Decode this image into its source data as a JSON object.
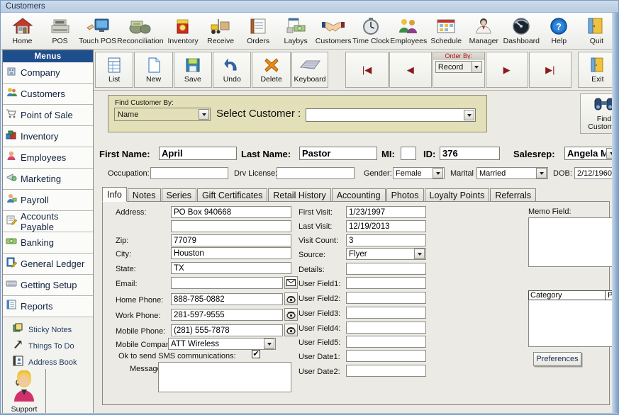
{
  "window": {
    "title": "Customers"
  },
  "toolbar": {
    "items": [
      {
        "label": "Home",
        "icon": "house-icon"
      },
      {
        "label": "POS",
        "icon": "cash-register-icon"
      },
      {
        "label": "Touch POS",
        "icon": "touch-monitor-icon"
      },
      {
        "label": "Reconciliation",
        "icon": "money-bags-icon"
      },
      {
        "label": "Inventory",
        "icon": "inventory-box-icon"
      },
      {
        "label": "Receive",
        "icon": "forklift-icon"
      },
      {
        "label": "Orders",
        "icon": "order-form-icon"
      },
      {
        "label": "Laybys",
        "icon": "layaway-money-icon"
      },
      {
        "label": "Customers",
        "icon": "handshake-icon"
      },
      {
        "label": "Time Clock",
        "icon": "stopwatch-icon"
      },
      {
        "label": "Employees",
        "icon": "employees-icon"
      },
      {
        "label": "Schedule",
        "icon": "calendar-icon"
      },
      {
        "label": "Manager",
        "icon": "manager-person-icon"
      },
      {
        "label": "Dashboard",
        "icon": "gauge-icon"
      },
      {
        "label": "Help",
        "icon": "question-circle-icon"
      },
      {
        "label": "Quit",
        "icon": "exit-door-icon"
      }
    ]
  },
  "recordbar": {
    "buttons": [
      {
        "label": "List",
        "icon": "list-grid-icon"
      },
      {
        "label": "New",
        "icon": "new-page-icon"
      },
      {
        "label": "Save",
        "icon": "floppy-disk-icon"
      },
      {
        "label": "Undo",
        "icon": "undo-arrow-icon"
      },
      {
        "label": "Delete",
        "icon": "delete-x-icon"
      },
      {
        "label": "Keyboard",
        "icon": "keyboard-icon"
      }
    ],
    "nav": {
      "first": "|◀",
      "prev": "◀",
      "next": "▶",
      "last": "▶|"
    },
    "order_by_label": "Order By:",
    "order_by_value": "Record",
    "exit_label": "Exit"
  },
  "sidebar": {
    "header": "Menus",
    "items": [
      {
        "label": "Company",
        "icon": "building-icon"
      },
      {
        "label": "Customers",
        "icon": "customers-icon"
      },
      {
        "label": "Point of Sale",
        "icon": "shopping-cart-icon"
      },
      {
        "label": "Inventory",
        "icon": "boxes-icon"
      },
      {
        "label": "Employees",
        "icon": "employee-icon"
      },
      {
        "label": "Marketing",
        "icon": "megaphone-icon"
      },
      {
        "label": "Payroll",
        "icon": "payroll-icon"
      },
      {
        "label": "Accounts Payable",
        "icon": "invoice-pencil-icon"
      },
      {
        "label": "Banking",
        "icon": "banknote-icon"
      },
      {
        "label": "General Ledger",
        "icon": "ledger-pencil-icon"
      },
      {
        "label": "Getting Setup",
        "icon": "setup-keyboard-icon"
      },
      {
        "label": "Reports",
        "icon": "report-book-icon"
      }
    ],
    "sub_items": [
      {
        "label": "Sticky Notes",
        "icon": "sticky-note-icon"
      },
      {
        "label": "Things To Do",
        "icon": "hammer-icon"
      },
      {
        "label": "Address Book",
        "icon": "address-book-icon"
      }
    ],
    "support": {
      "label": "Support",
      "icon": "support-agent-icon"
    }
  },
  "find": {
    "find_by_label": "Find Customer By:",
    "find_by_value": "Name",
    "select_customer_label": "Select Customer :",
    "select_customer_value": "",
    "find_button_line1": "Find",
    "find_button_line2": "Customer",
    "find_button_icon": "binoculars-icon"
  },
  "header_fields": {
    "first_name_label": "First Name:",
    "first_name_value": "April",
    "last_name_label": "Last Name:",
    "last_name_value": "Pastor",
    "mi_label": "MI:",
    "mi_value": "",
    "id_label": "ID:",
    "id_value": "376",
    "salesrep_label": "Salesrep:",
    "salesrep_value": "Angela Meyer",
    "occupation_label": "Occupation:",
    "occupation_value": "",
    "drv_license_label": "Drv License:",
    "drv_license_value": "",
    "gender_label": "Gender:",
    "gender_value": "Female",
    "marital_label": "Marital",
    "marital_value": "Married",
    "dob_label": "DOB:",
    "dob_value": "2/12/1960"
  },
  "tabs": [
    {
      "label": "Info",
      "active": true
    },
    {
      "label": "Notes",
      "active": false
    },
    {
      "label": "Series",
      "active": false
    },
    {
      "label": "Gift Certificates",
      "active": false
    },
    {
      "label": "Retail History",
      "active": false
    },
    {
      "label": "Accounting",
      "active": false
    },
    {
      "label": "Photos",
      "active": false
    },
    {
      "label": "Loyalty Points",
      "active": false
    },
    {
      "label": "Referrals",
      "active": false
    }
  ],
  "info": {
    "address_label": "Address:",
    "address_value": "PO Box 940668",
    "address2_value": "",
    "zip_label": "Zip:",
    "zip_value": "77079",
    "city_label": "City:",
    "city_value": "Houston",
    "state_label": "State:",
    "state_value": "TX",
    "email_label": "Email:",
    "email_value": "",
    "email_icon": "envelope-icon",
    "home_phone_label": "Home Phone:",
    "home_phone_value": "888-785-0882",
    "home_phone_icon": "telephone-icon",
    "work_phone_label": "Work Phone:",
    "work_phone_value": "281-597-9555",
    "work_phone_icon": "telephone-icon",
    "mobile_phone_label": "Mobile Phone:",
    "mobile_phone_value": "(281) 555-7878",
    "mobile_phone_icon": "telephone-icon",
    "mobile_company_label": "Mobile Company:",
    "mobile_company_value": "ATT Wireless",
    "sms_label": "Ok to send SMS communications:",
    "sms_checked": "✔",
    "message_label": "Message:",
    "message_value": "",
    "first_visit_label": "First Visit:",
    "first_visit_value": "1/23/1997",
    "last_visit_label": "Last Visit:",
    "last_visit_value": "12/19/2013",
    "visit_count_label": "Visit Count:",
    "visit_count_value": "3",
    "source_label": "Source:",
    "source_value": "Flyer",
    "details_label": "Details:",
    "details_value": "",
    "user_field1_label": "User Field1:",
    "user_field1_value": "",
    "user_field2_label": "User Field2:",
    "user_field2_value": "",
    "user_field3_label": "User Field3:",
    "user_field3_value": "",
    "user_field4_label": "User Field4:",
    "user_field4_value": "",
    "user_field5_label": "User Field5:",
    "user_field5_value": "",
    "user_date1_label": "User Date1:",
    "user_date1_value": "",
    "user_date2_label": "User Date2:",
    "user_date2_value": "",
    "memo_label": "Memo Field:",
    "memo_value": "",
    "grid_col1": "Category",
    "grid_col2": "Preference",
    "preferences_button": "Preferences"
  },
  "colors": {
    "menu_header": "#1f4e8c",
    "findbar_bg": "#e3dfb9",
    "nav_arrow": "#8b1a1a",
    "order_by_text": "#b01010",
    "titlebar": "#c2d2e4"
  }
}
